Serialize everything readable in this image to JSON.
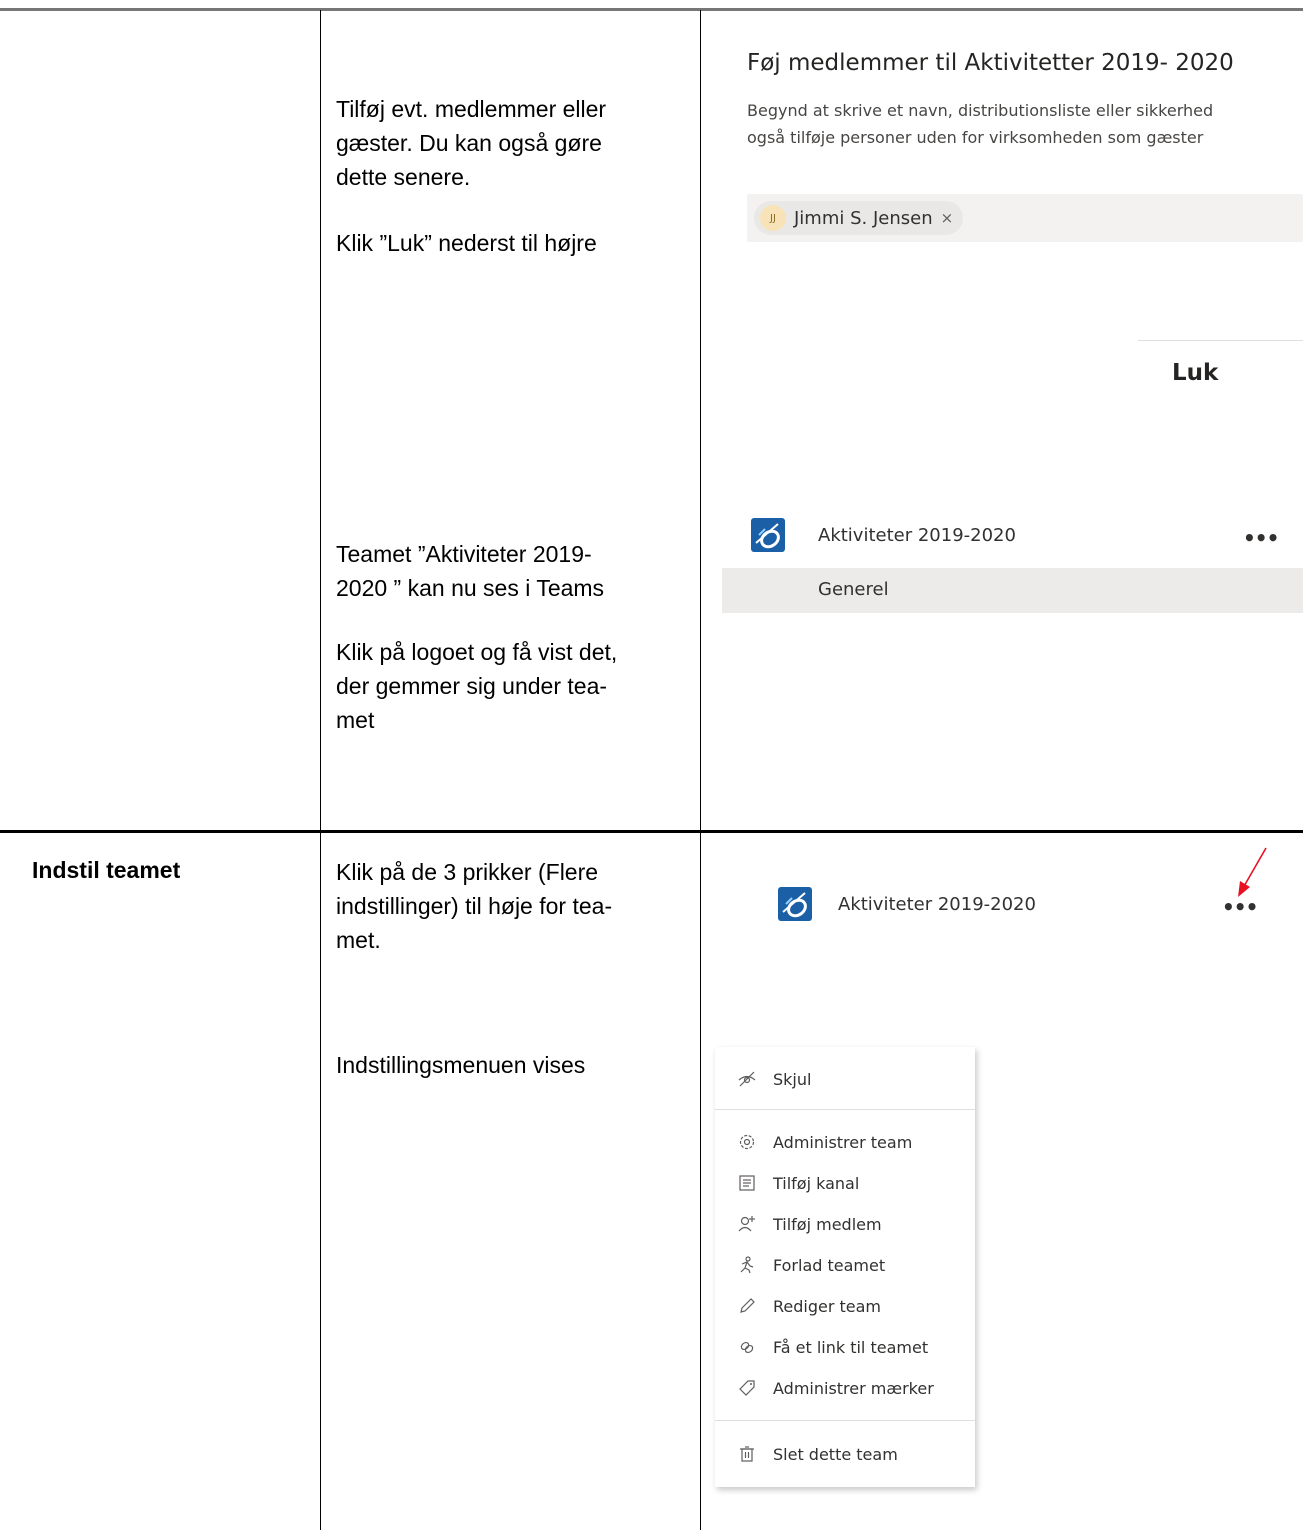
{
  "row1": {
    "instruction1": [
      "Tilføj evt. medlemmer eller",
      "gæster. Du kan også gøre",
      "dette senere."
    ],
    "instruction2": "Klik ”Luk” nederst til højre",
    "instruction3": [
      "Teamet ”Aktiviteter 2019-",
      "2020 ” kan nu ses i Teams"
    ],
    "instruction4": [
      "Klik på logoet og få vist det,",
      "der gemmer sig under tea-",
      "met"
    ]
  },
  "dialog": {
    "title": "Føj medlemmer til Aktivitetter 2019- 2020",
    "sub_line1": "Begynd at skrive et navn, distributionsliste eller sikkerhed",
    "sub_line2": "også tilføje personer uden for virksomheden som gæster",
    "chip_initials": "JJ",
    "chip_name": "Jimmi S. Jensen",
    "chip_remove": "×",
    "close_label": "Luk"
  },
  "team_card": {
    "team_name": "Aktiviteter 2019-2020",
    "more": "•••",
    "channel": "Generel"
  },
  "row2": {
    "heading": "Indstil teamet",
    "instruction1": [
      "Klik på de 3 prikker (Flere",
      "indstillinger) til høje for tea-",
      "met."
    ],
    "instruction2": "Indstillingsmenuen vises"
  },
  "team_card2": {
    "team_name": "Aktiviteter 2019-2020",
    "more": "•••",
    "arrow_color": "#e81123"
  },
  "menu": {
    "items": [
      {
        "label": "Skjul",
        "icon": "hide-icon"
      },
      {
        "label": "Administrer team",
        "icon": "gear-icon"
      },
      {
        "label": "Tilføj kanal",
        "icon": "channel-icon"
      },
      {
        "label": "Tilføj medlem",
        "icon": "add-member-icon"
      },
      {
        "label": "Forlad teamet",
        "icon": "leave-icon"
      },
      {
        "label": "Rediger team",
        "icon": "pencil-icon"
      },
      {
        "label": "Få et link til teamet",
        "icon": "link-icon"
      },
      {
        "label": "Administrer mærker",
        "icon": "tag-icon"
      },
      {
        "label": "Slet dette team",
        "icon": "trash-icon"
      }
    ]
  }
}
